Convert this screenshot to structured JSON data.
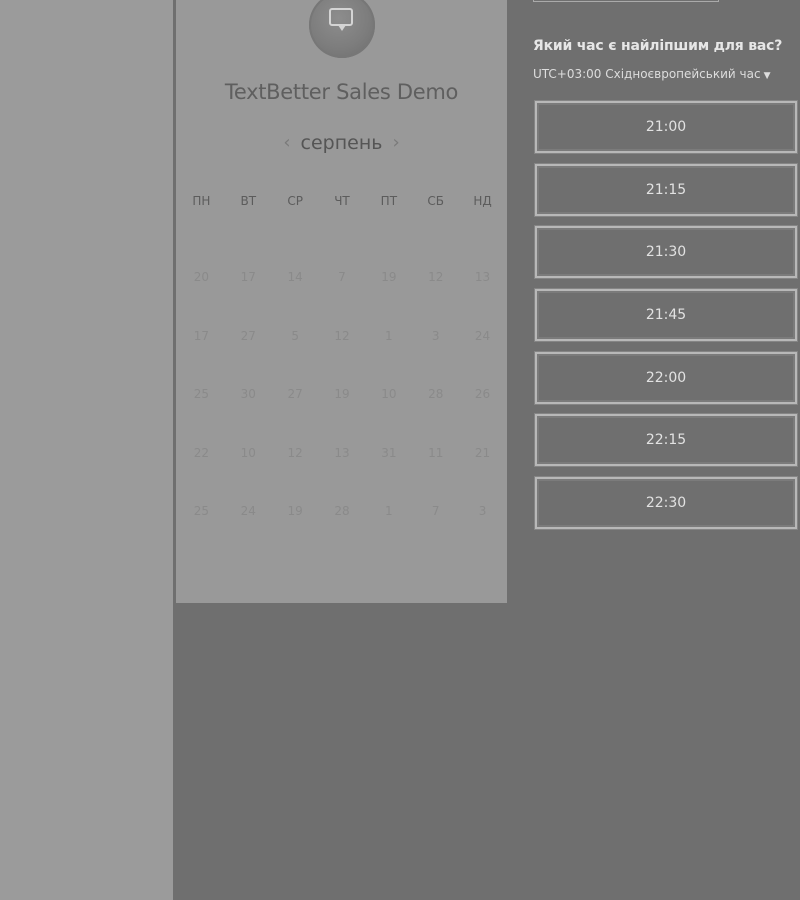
{
  "booking": {
    "title": "TextBetter Sales Demo",
    "calendar": {
      "month": "серпень",
      "prev_icon": "chevron-left-icon",
      "next_icon": "chevron-right-icon",
      "weekdays": [
        "ПН",
        "ВТ",
        "СР",
        "ЧТ",
        "ПТ",
        "СБ",
        "НД"
      ],
      "weeks": [
        [
          "20",
          "17",
          "14",
          "7",
          "19",
          "12",
          "13"
        ],
        [
          "17",
          "27",
          "5",
          "12",
          "1",
          "3",
          "24"
        ],
        [
          "25",
          "30",
          "27",
          "19",
          "10",
          "28",
          "26"
        ],
        [
          "22",
          "10",
          "12",
          "13",
          "31",
          "11",
          "21"
        ],
        [
          "25",
          "24",
          "19",
          "28",
          "1",
          "7",
          "3"
        ]
      ]
    },
    "time_picker": {
      "heading": "Який час є найліпшим для вас?",
      "timezone": "UTC+03:00 Східноєвропейський час",
      "timezone_icon": "caret-down-icon",
      "slots": [
        "21:00",
        "21:15",
        "21:30",
        "21:45",
        "22:00",
        "22:15",
        "22:30"
      ]
    }
  },
  "colors": {
    "page_background": "#9b9b9b",
    "overlay": "#6f6f6f",
    "calendar_panel": "#999999",
    "slot_text": "#e2e2e2"
  }
}
